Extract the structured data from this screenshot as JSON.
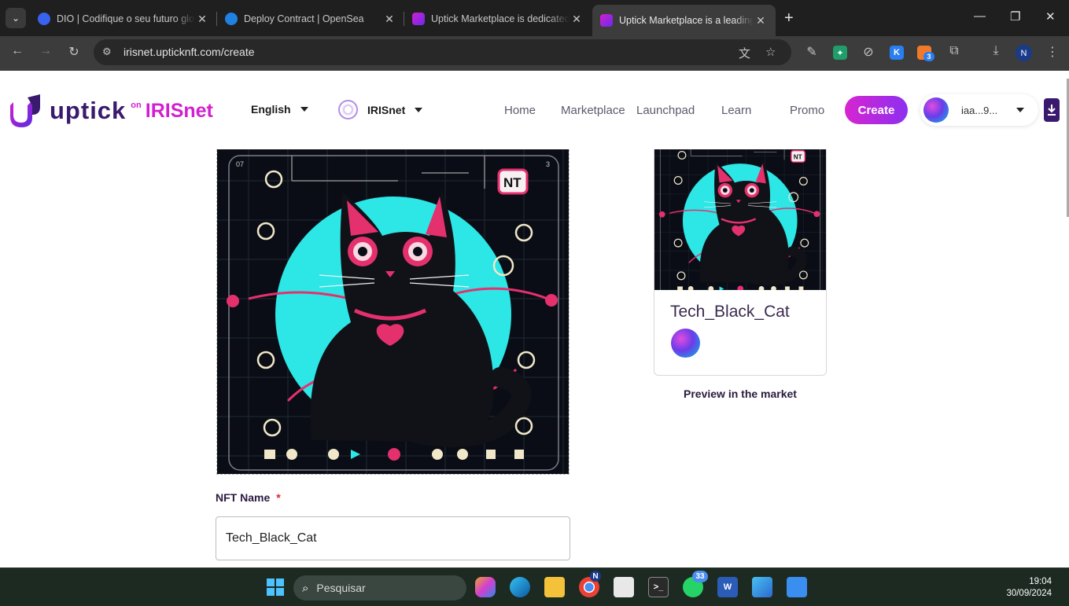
{
  "browser": {
    "tabs": [
      {
        "title": "DIO | Codifique o seu futuro global",
        "icon": "dio-favicon"
      },
      {
        "title": "Deploy Contract | OpenSea",
        "icon": "opensea-favicon"
      },
      {
        "title": "Uptick Marketplace is dedicated",
        "icon": "uptick-favicon"
      },
      {
        "title": "Uptick Marketplace is a leading",
        "icon": "uptick-favicon",
        "active": true
      }
    ],
    "url": "irisnet.upticknft.com/create",
    "extension_badge": "3",
    "profile_initial": "N"
  },
  "header": {
    "logo_word": "uptick",
    "logo_on": "on",
    "logo_network": "IRISnet",
    "language": "English",
    "chain": "IRISnet",
    "nav": [
      "Home",
      "Marketplace",
      "Launchpad",
      "Learn",
      "Promo"
    ],
    "create_label": "Create",
    "account": "iaa...9..."
  },
  "main": {
    "nft_image_alt": "black cat nft artwork",
    "art_text": {
      "corner_left": "07",
      "corner_right": "3",
      "badge": "NT"
    },
    "preview_title": "Tech_Black_Cat",
    "preview_caption": "Preview in the market",
    "nft_name_label": "NFT Name",
    "required_mark": "*",
    "nft_name_value": "Tech_Black_Cat"
  },
  "taskbar": {
    "search_placeholder": "Pesquisar",
    "whatsapp_badge": "33",
    "chrome_badge": "N",
    "time": "19:04",
    "date": "30/09/2024"
  },
  "colors": {
    "brand_dark": "#3a1a6e",
    "brand_magenta": "#d21fd0",
    "art_cyan": "#2de6e6",
    "art_pink": "#e5306e"
  }
}
